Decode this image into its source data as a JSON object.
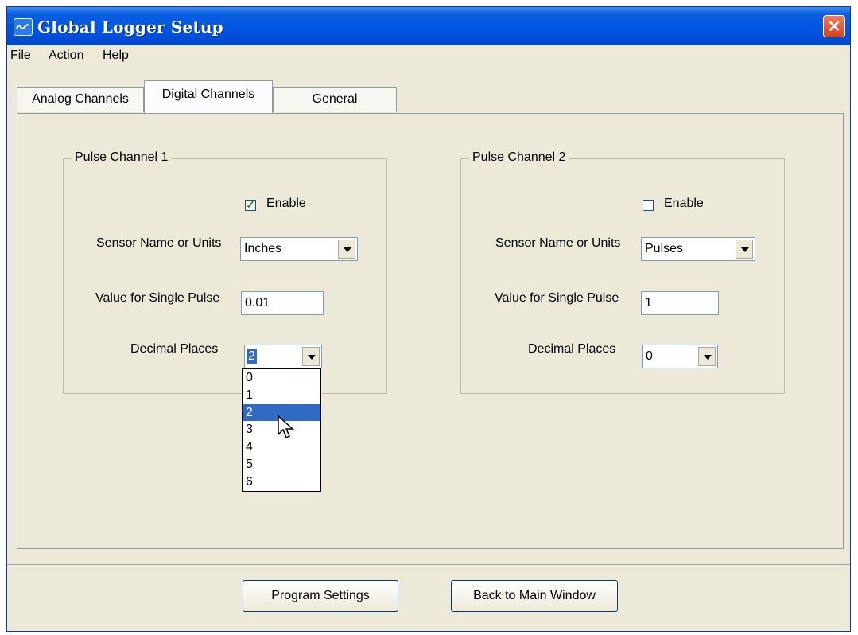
{
  "window": {
    "title": "Global Logger Setup"
  },
  "menu": {
    "items": [
      "File",
      "Action",
      "Help"
    ]
  },
  "tabs": [
    {
      "label": "Analog Channels"
    },
    {
      "label": "Digital Channels"
    },
    {
      "label": "General"
    }
  ],
  "channel1": {
    "legend": "Pulse Channel 1",
    "enable_label": "Enable",
    "enabled": true,
    "sensor_label": "Sensor Name or Units",
    "sensor_value": "Inches",
    "pulse_label": "Value for Single Pulse",
    "pulse_value": "0.01",
    "decimal_label": "Decimal Places",
    "decimal_value": "2",
    "decimal_options": [
      "0",
      "1",
      "2",
      "3",
      "4",
      "5",
      "6"
    ],
    "decimal_highlighted": "2"
  },
  "channel2": {
    "legend": "Pulse Channel 2",
    "enable_label": "Enable",
    "enabled": false,
    "sensor_label": "Sensor Name or Units",
    "sensor_value": "Pulses",
    "pulse_label": "Value for Single Pulse",
    "pulse_value": "1",
    "decimal_label": "Decimal Places",
    "decimal_value": "0"
  },
  "buttons": {
    "program": "Program Settings",
    "back": "Back to Main Window"
  },
  "colors": {
    "titlebar": "#0054e3",
    "face": "#ece9d8",
    "selection": "#316ac5",
    "close": "#d8401c"
  }
}
